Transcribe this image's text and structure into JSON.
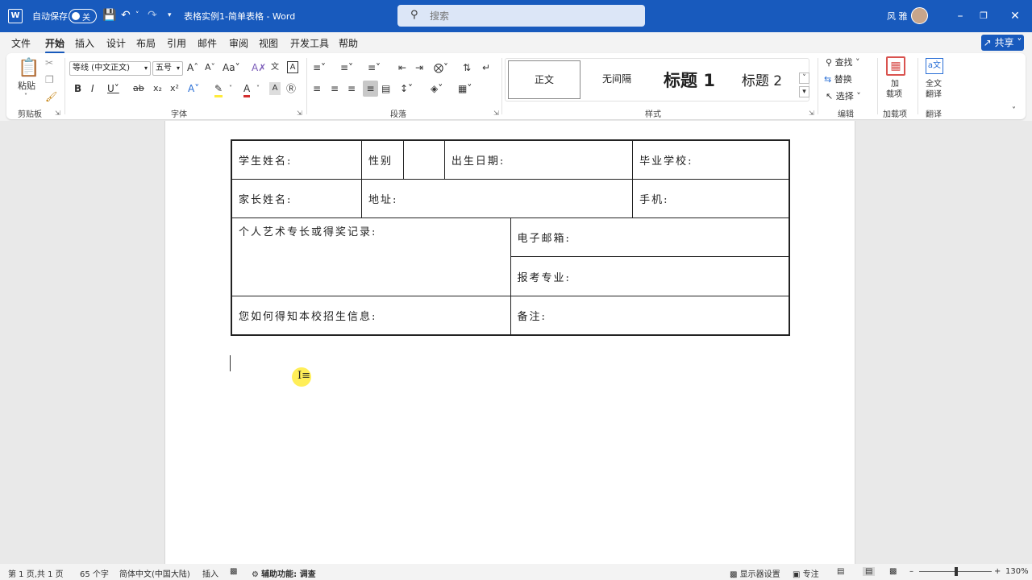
{
  "titlebar": {
    "autosave_label": "自动保存",
    "autosave_state": "关",
    "doc_title": "表格实例1-简单表格 - Word",
    "search_placeholder": "搜索",
    "user_name": "风 雅",
    "colors": {
      "bar": "#185abd"
    }
  },
  "menu": {
    "tabs": [
      "文件",
      "开始",
      "插入",
      "设计",
      "布局",
      "引用",
      "邮件",
      "审阅",
      "视图",
      "开发工具",
      "帮助"
    ],
    "active": "开始",
    "share_label": "共享"
  },
  "ribbon": {
    "clipboard": {
      "paste_label": "粘贴",
      "group_label": "剪贴板"
    },
    "font": {
      "font_name": "等线 (中文正文)",
      "font_size": "五号",
      "group_label": "字体"
    },
    "paragraph": {
      "group_label": "段落"
    },
    "styles": {
      "group_label": "样式",
      "items": [
        "正文",
        "无间隔",
        "标题 1",
        "标题 2"
      ]
    },
    "editing": {
      "group_label": "编辑",
      "find_label": "查找",
      "replace_label": "替换",
      "select_label": "选择"
    },
    "addins": {
      "label_line1": "加",
      "label_line2": "载项",
      "group_label": "加载项"
    },
    "translate": {
      "label_line1": "全文",
      "label_line2": "翻译",
      "group_label": "翻译"
    }
  },
  "document": {
    "table": {
      "student_name": "学生姓名:",
      "gender": "性别",
      "birth_date": "出生日期:",
      "graduate_school": "毕业学校:",
      "parent_name": "家长姓名:",
      "address": "地址:",
      "phone": "手机:",
      "art_record": "个人艺术专长或得奖记录:",
      "email": "电子邮箱:",
      "major": "报考专业:",
      "info_source": "您如何得知本校招生信息:",
      "remarks": "备注:"
    }
  },
  "statusbar": {
    "page_info": "第 1 页,共 1 页",
    "word_count": "65 个字",
    "language": "简体中文(中国大陆)",
    "insert_mode": "插入",
    "accessibility": "辅助功能: 调查",
    "display_settings": "显示器设置",
    "focus": "专注",
    "zoom": "130%"
  }
}
